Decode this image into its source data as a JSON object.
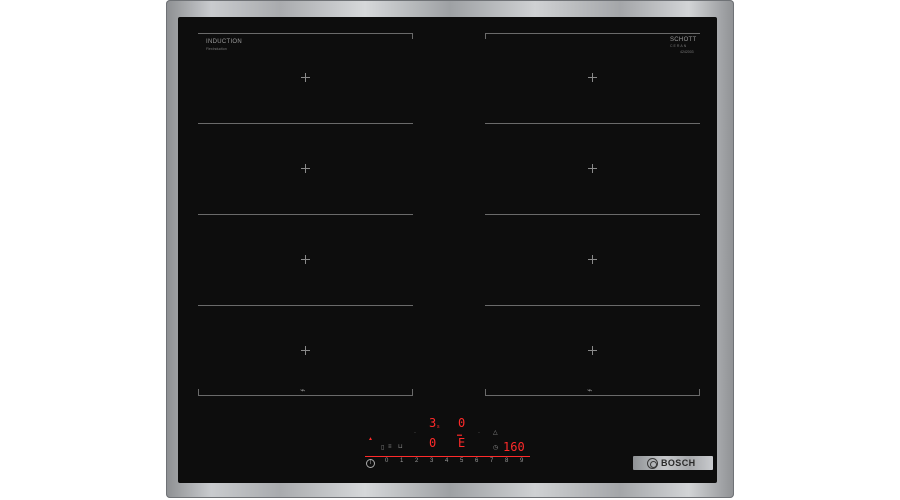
{
  "brand": {
    "left_label": "INDUCTION",
    "left_sub": "FlexInduction",
    "right_label_1": "SCHOTT",
    "right_label_2": "CERAN",
    "right_sub": "4242003"
  },
  "display": {
    "left_top_digit": "3",
    "left_top_suffix": "s",
    "left_bottom_digit": "0",
    "right_top_digit": "0",
    "right_bottom_digit": "E",
    "timer_value": "160"
  },
  "slider": {
    "values": [
      "0",
      "1",
      "2",
      "3",
      "4",
      "5",
      "6",
      "7",
      "8",
      "9"
    ]
  },
  "badge": {
    "wordmark": "BOSCH"
  },
  "icons": {
    "flex_left": "flex-zone-icon",
    "flex_right": "flex-zone-icon",
    "power": "power-icon",
    "timer": "clock-icon",
    "child_lock": "key-icon"
  }
}
